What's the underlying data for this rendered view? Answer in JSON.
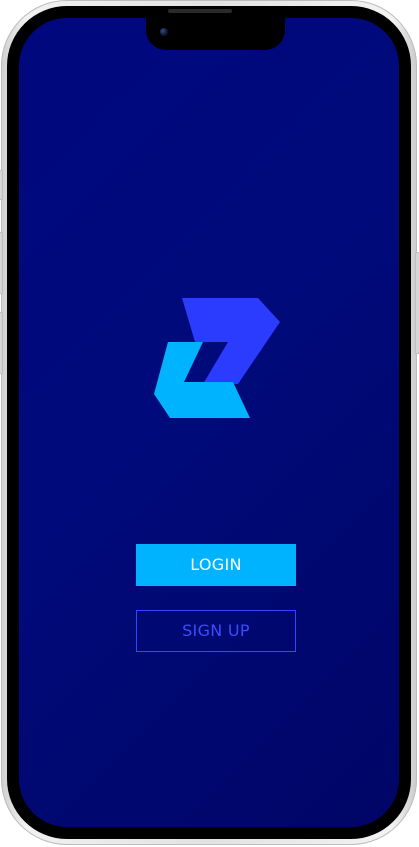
{
  "buttons": {
    "login_label": "LOGIN",
    "signup_label": "SIGN UP"
  },
  "icons": {
    "logo": "z-logo-icon",
    "camera": "front-camera-icon"
  },
  "colors": {
    "background_top": "#00087f",
    "background_bottom": "#000566",
    "logo_dark": "#2c3cff",
    "logo_light": "#00b3ff",
    "login_button": "#00b3ff",
    "signup_border": "#3445ff"
  }
}
